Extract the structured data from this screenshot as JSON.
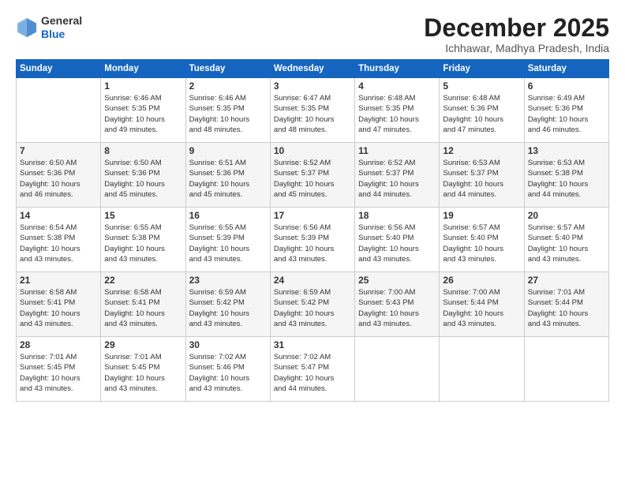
{
  "header": {
    "logo_general": "General",
    "logo_blue": "Blue",
    "month_title": "December 2025",
    "location": "Ichhawar, Madhya Pradesh, India"
  },
  "weekdays": [
    "Sunday",
    "Monday",
    "Tuesday",
    "Wednesday",
    "Thursday",
    "Friday",
    "Saturday"
  ],
  "weeks": [
    [
      {
        "day": "",
        "info": ""
      },
      {
        "day": "1",
        "info": "Sunrise: 6:46 AM\nSunset: 5:35 PM\nDaylight: 10 hours\nand 49 minutes."
      },
      {
        "day": "2",
        "info": "Sunrise: 6:46 AM\nSunset: 5:35 PM\nDaylight: 10 hours\nand 48 minutes."
      },
      {
        "day": "3",
        "info": "Sunrise: 6:47 AM\nSunset: 5:35 PM\nDaylight: 10 hours\nand 48 minutes."
      },
      {
        "day": "4",
        "info": "Sunrise: 6:48 AM\nSunset: 5:35 PM\nDaylight: 10 hours\nand 47 minutes."
      },
      {
        "day": "5",
        "info": "Sunrise: 6:48 AM\nSunset: 5:36 PM\nDaylight: 10 hours\nand 47 minutes."
      },
      {
        "day": "6",
        "info": "Sunrise: 6:49 AM\nSunset: 5:36 PM\nDaylight: 10 hours\nand 46 minutes."
      }
    ],
    [
      {
        "day": "7",
        "info": "Sunrise: 6:50 AM\nSunset: 5:36 PM\nDaylight: 10 hours\nand 46 minutes."
      },
      {
        "day": "8",
        "info": "Sunrise: 6:50 AM\nSunset: 5:36 PM\nDaylight: 10 hours\nand 45 minutes."
      },
      {
        "day": "9",
        "info": "Sunrise: 6:51 AM\nSunset: 5:36 PM\nDaylight: 10 hours\nand 45 minutes."
      },
      {
        "day": "10",
        "info": "Sunrise: 6:52 AM\nSunset: 5:37 PM\nDaylight: 10 hours\nand 45 minutes."
      },
      {
        "day": "11",
        "info": "Sunrise: 6:52 AM\nSunset: 5:37 PM\nDaylight: 10 hours\nand 44 minutes."
      },
      {
        "day": "12",
        "info": "Sunrise: 6:53 AM\nSunset: 5:37 PM\nDaylight: 10 hours\nand 44 minutes."
      },
      {
        "day": "13",
        "info": "Sunrise: 6:53 AM\nSunset: 5:38 PM\nDaylight: 10 hours\nand 44 minutes."
      }
    ],
    [
      {
        "day": "14",
        "info": "Sunrise: 6:54 AM\nSunset: 5:38 PM\nDaylight: 10 hours\nand 43 minutes."
      },
      {
        "day": "15",
        "info": "Sunrise: 6:55 AM\nSunset: 5:38 PM\nDaylight: 10 hours\nand 43 minutes."
      },
      {
        "day": "16",
        "info": "Sunrise: 6:55 AM\nSunset: 5:39 PM\nDaylight: 10 hours\nand 43 minutes."
      },
      {
        "day": "17",
        "info": "Sunrise: 6:56 AM\nSunset: 5:39 PM\nDaylight: 10 hours\nand 43 minutes."
      },
      {
        "day": "18",
        "info": "Sunrise: 6:56 AM\nSunset: 5:40 PM\nDaylight: 10 hours\nand 43 minutes."
      },
      {
        "day": "19",
        "info": "Sunrise: 6:57 AM\nSunset: 5:40 PM\nDaylight: 10 hours\nand 43 minutes."
      },
      {
        "day": "20",
        "info": "Sunrise: 6:57 AM\nSunset: 5:40 PM\nDaylight: 10 hours\nand 43 minutes."
      }
    ],
    [
      {
        "day": "21",
        "info": "Sunrise: 6:58 AM\nSunset: 5:41 PM\nDaylight: 10 hours\nand 43 minutes."
      },
      {
        "day": "22",
        "info": "Sunrise: 6:58 AM\nSunset: 5:41 PM\nDaylight: 10 hours\nand 43 minutes."
      },
      {
        "day": "23",
        "info": "Sunrise: 6:59 AM\nSunset: 5:42 PM\nDaylight: 10 hours\nand 43 minutes."
      },
      {
        "day": "24",
        "info": "Sunrise: 6:59 AM\nSunset: 5:42 PM\nDaylight: 10 hours\nand 43 minutes."
      },
      {
        "day": "25",
        "info": "Sunrise: 7:00 AM\nSunset: 5:43 PM\nDaylight: 10 hours\nand 43 minutes."
      },
      {
        "day": "26",
        "info": "Sunrise: 7:00 AM\nSunset: 5:44 PM\nDaylight: 10 hours\nand 43 minutes."
      },
      {
        "day": "27",
        "info": "Sunrise: 7:01 AM\nSunset: 5:44 PM\nDaylight: 10 hours\nand 43 minutes."
      }
    ],
    [
      {
        "day": "28",
        "info": "Sunrise: 7:01 AM\nSunset: 5:45 PM\nDaylight: 10 hours\nand 43 minutes."
      },
      {
        "day": "29",
        "info": "Sunrise: 7:01 AM\nSunset: 5:45 PM\nDaylight: 10 hours\nand 43 minutes."
      },
      {
        "day": "30",
        "info": "Sunrise: 7:02 AM\nSunset: 5:46 PM\nDaylight: 10 hours\nand 43 minutes."
      },
      {
        "day": "31",
        "info": "Sunrise: 7:02 AM\nSunset: 5:47 PM\nDaylight: 10 hours\nand 44 minutes."
      },
      {
        "day": "",
        "info": ""
      },
      {
        "day": "",
        "info": ""
      },
      {
        "day": "",
        "info": ""
      }
    ]
  ]
}
